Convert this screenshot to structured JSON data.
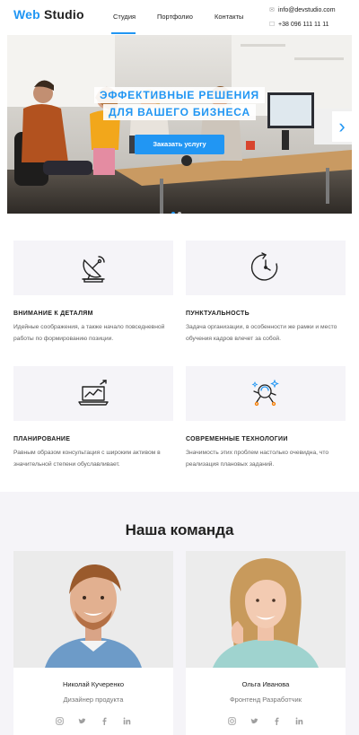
{
  "header": {
    "logo_accent": "Web",
    "logo_rest": "Studio",
    "nav": [
      {
        "label": "Студия",
        "active": true
      },
      {
        "label": "Портфолио",
        "active": false
      },
      {
        "label": "Контакты",
        "active": false
      }
    ],
    "email": "info@devstudio.com",
    "phone": "+38 096 111 11 11"
  },
  "hero": {
    "title_line1": "ЭФФЕКТИВНЫЕ РЕШЕНИЯ",
    "title_line2": "ДЛЯ ВАШЕГО БИЗНЕСА",
    "cta": "Заказать услугу",
    "next_arrow": "›",
    "slides_count": 2,
    "active_slide": 1
  },
  "features": [
    {
      "icon": "satellite-dish-icon",
      "title": "ВНИМАНИЕ К ДЕТАЛЯМ",
      "text": "Идейные соображения, а также начало повседневной работы по формированию позиции."
    },
    {
      "icon": "clock-icon",
      "title": "ПУНКТУАЛЬНОСТЬ",
      "text": "Задача организации, в особенности же рамки и место обучения кадров влечет за собой."
    },
    {
      "icon": "laptop-chart-icon",
      "title": "ПЛАНИРОВАНИЕ",
      "text": "Равным образом консультация с широким активом в значительной степени обуславливает."
    },
    {
      "icon": "astronaut-icon",
      "title": "СОВРЕМЕННЫЕ ТЕХНОЛОГИИ",
      "text": "Значимость этих проблем настолько очевидна, что реализация плановых заданий."
    }
  ],
  "team": {
    "title": "Наша команда",
    "members": [
      {
        "name": "Николай Кучеренко",
        "role": "Дизайнер продукта",
        "socials": [
          "instagram-icon",
          "twitter-icon",
          "facebook-icon",
          "linkedin-icon"
        ]
      },
      {
        "name": "Ольга Иванова",
        "role": "Фронтенд Разработчик",
        "socials": [
          "instagram-icon",
          "twitter-icon",
          "facebook-icon",
          "linkedin-icon"
        ]
      }
    ]
  },
  "colors": {
    "accent": "#2196f3",
    "text": "#212121",
    "muted": "#757575",
    "section_bg": "#f5f4f8"
  }
}
